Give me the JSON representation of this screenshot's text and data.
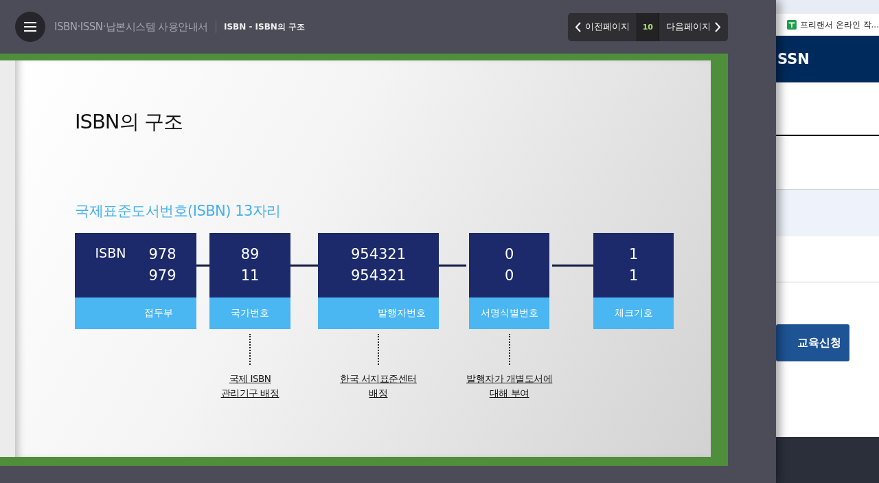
{
  "header": {
    "title": "ISBN·ISSN·납본시스템 사용안내서",
    "breadcrumb": "ISBN - ISBN의 구조"
  },
  "pager": {
    "previous": "이전페이지",
    "page": "10",
    "next": "다음페이지"
  },
  "slide": {
    "title": "ISBN의 구조",
    "subtitle": "국제표준도서번호(ISBN) 13자리",
    "segments": [
      {
        "prefix": "ISBN",
        "numbers": [
          "978",
          "979"
        ],
        "label": "접두부"
      },
      {
        "numbers": [
          "89",
          "11"
        ],
        "label": "국가번호",
        "note": [
          "국제 ISBN",
          "관리기구 배정"
        ]
      },
      {
        "numbers": [
          "954321",
          "954321"
        ],
        "label": "발행자번호",
        "note": [
          "한국 서지표준센터",
          "배정"
        ]
      },
      {
        "numbers": [
          "0",
          "0"
        ],
        "label": "서명식별번호",
        "note": [
          "발행자가 개별도서에",
          "대해 부여"
        ]
      },
      {
        "numbers": [
          "1",
          "1"
        ],
        "label": "체크기호"
      }
    ]
  },
  "side_window": {
    "bookmark": "프리랜서 온라인 작...",
    "banner": "SSN",
    "button": "교육신청"
  }
}
